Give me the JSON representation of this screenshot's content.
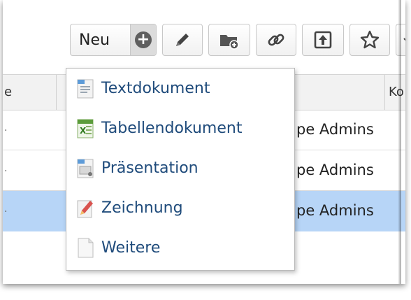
{
  "toolbar": {
    "new_label": "Neu",
    "buttons": [
      "edit-icon",
      "new-folder-icon",
      "link-icon",
      "upload-icon",
      "star-icon"
    ]
  },
  "table": {
    "header_left_fragment": "e",
    "header_right_fragment": "Ko",
    "rows": [
      {
        "text": "pe Admins",
        "selected": false
      },
      {
        "text": "pe Admins",
        "selected": false
      },
      {
        "text": "pe Admins",
        "selected": true
      }
    ]
  },
  "new_menu": {
    "items": [
      {
        "label": "Textdokument",
        "icon": "text-document-icon"
      },
      {
        "label": "Tabellendokument",
        "icon": "spreadsheet-icon"
      },
      {
        "label": "Präsentation",
        "icon": "presentation-icon"
      },
      {
        "label": "Zeichnung",
        "icon": "drawing-icon"
      },
      {
        "label": "Weitere",
        "icon": "blank-document-icon"
      }
    ]
  },
  "colors": {
    "menu_text": "#1f4b7b",
    "selected_row": "#b7d5f7"
  }
}
